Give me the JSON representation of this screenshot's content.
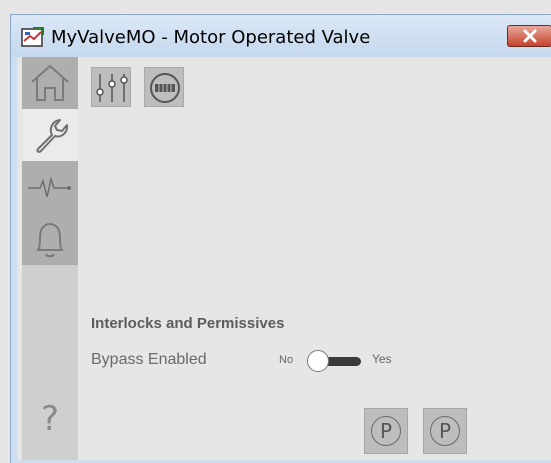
{
  "window": {
    "title": "MyValveMO - Motor Operated Valve",
    "close_icon": "close-icon",
    "accent": "#c4432e"
  },
  "sidebar": {
    "items": [
      {
        "name": "home",
        "icon": "home-icon",
        "selected": false
      },
      {
        "name": "maintenance",
        "icon": "wrench-icon",
        "selected": true
      },
      {
        "name": "trends",
        "icon": "trend-icon",
        "selected": false
      },
      {
        "name": "alarms",
        "icon": "bell-icon",
        "selected": false
      }
    ],
    "help_label": "?"
  },
  "toolbar": {
    "buttons": [
      {
        "name": "settings",
        "icon": "sliders-icon"
      },
      {
        "name": "bypass-indicator",
        "icon": "bypass-icon"
      }
    ]
  },
  "interlocks": {
    "section_title": "Interlocks and Permissives",
    "bypass_label": "Bypass Enabled",
    "toggle_off_label": "No",
    "toggle_on_label": "Yes",
    "bypass_enabled": false
  },
  "permissive_buttons": [
    {
      "label": "P"
    },
    {
      "label": "P"
    }
  ]
}
